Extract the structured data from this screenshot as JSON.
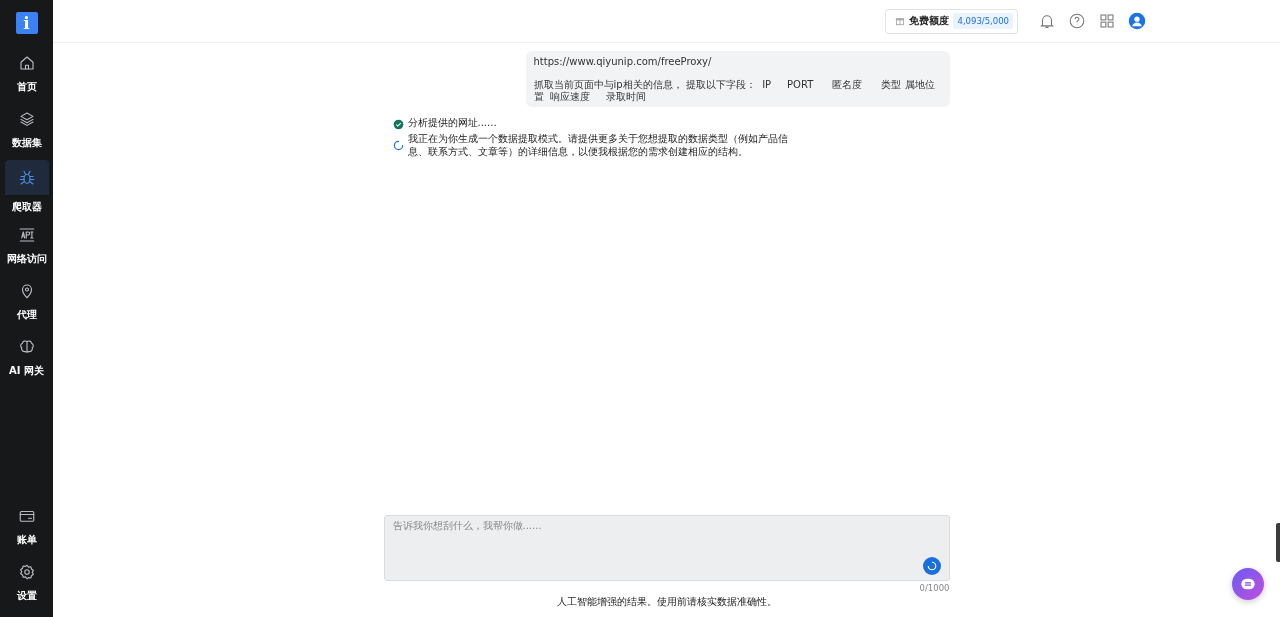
{
  "sidebar": {
    "logo": "i",
    "items": [
      {
        "label": "首页",
        "kind": "home",
        "selected": false
      },
      {
        "label": "数据集",
        "kind": "layers",
        "selected": false
      },
      {
        "label": "爬取器",
        "kind": "bug",
        "selected": true
      },
      {
        "label": "网络访问",
        "kind": "api",
        "selected": false
      },
      {
        "label": "代理",
        "kind": "pin",
        "selected": false
      },
      {
        "label": "AI 网关",
        "kind": "brain",
        "selected": false
      }
    ],
    "bottom_items": [
      {
        "label": "账单",
        "kind": "card",
        "selected": false
      },
      {
        "label": "设置",
        "kind": "gear",
        "selected": false
      }
    ]
  },
  "header": {
    "quota_label": "免费额度",
    "quota_value": "4,093/5,000"
  },
  "conversation": {
    "user_message": {
      "url": "https://www.qiyunip.com/freeProxy/",
      "text": "抓取当前页面中与ip相关的信息， 提取以下字段：  IP     PORT      匿名度      类型 属地位置  响应速度     录取时间"
    },
    "steps": [
      {
        "kind": "done",
        "text": "分析提供的网址......"
      },
      {
        "kind": "loading",
        "text": "我正在为你生成一个数据提取模式。请提供更多关于您想提取的数据类型（例如产品信息、联系方式、文章等）的详细信息，以便我根据您的需求创建相应的结构。"
      }
    ]
  },
  "composer": {
    "placeholder": "告诉我你想刮什么，我帮你做......",
    "counter": "0/1000",
    "disclaimer": "人工智能增强的结果。使用前请核实数据准确性。"
  }
}
